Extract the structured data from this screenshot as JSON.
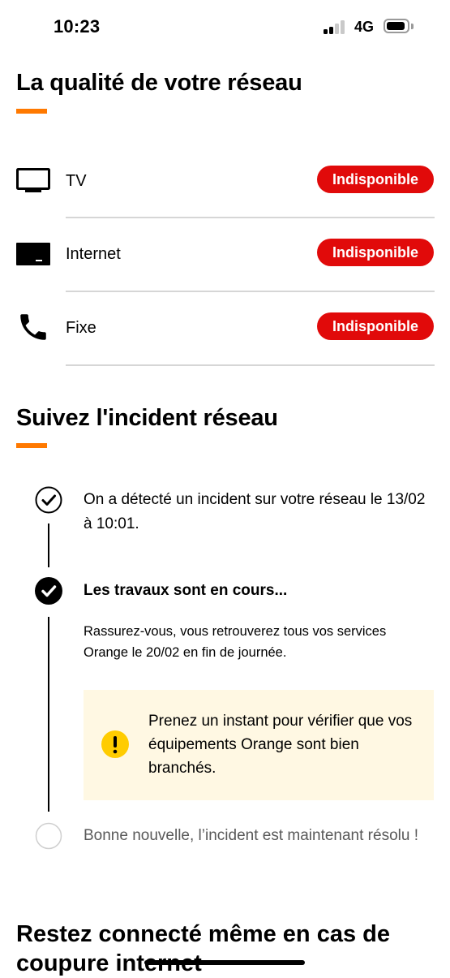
{
  "status_bar": {
    "time": "10:23",
    "network": "4G",
    "signal_bars_active": 2,
    "signal_bars_total": 4
  },
  "network_quality": {
    "title": "La qualité de votre réseau",
    "services": [
      {
        "label": "TV",
        "status": "Indisponible",
        "icon": "tv-icon"
      },
      {
        "label": "Internet",
        "status": "Indisponible",
        "icon": "router-box-icon"
      },
      {
        "label": "Fixe",
        "status": "Indisponible",
        "icon": "phone-icon"
      }
    ]
  },
  "incident": {
    "title": "Suivez l'incident réseau",
    "steps": [
      {
        "text": "On a détecté un incident sur votre réseau le 13/02 à 10:01.",
        "state": "done"
      },
      {
        "text": "Les travaux sont en cours...",
        "state": "current"
      },
      {
        "text": "Bonne nouvelle, l’incident est maintenant résolu !",
        "state": "pending"
      }
    ],
    "current_detail": "Rassurez-vous, vous retrouverez tous vos services Orange le 20/02 en fin de journée.",
    "info_box": "Prenez un instant pour vérifier que vos équipements Orange sont bien branchés."
  },
  "stay_connected": {
    "title": "Restez connecté même en cas de coupure internet"
  },
  "colors": {
    "accent": "#ff7900",
    "status_red": "#e10a0a",
    "info_bg": "#fff8e3",
    "warning_yellow": "#ffcc00"
  }
}
